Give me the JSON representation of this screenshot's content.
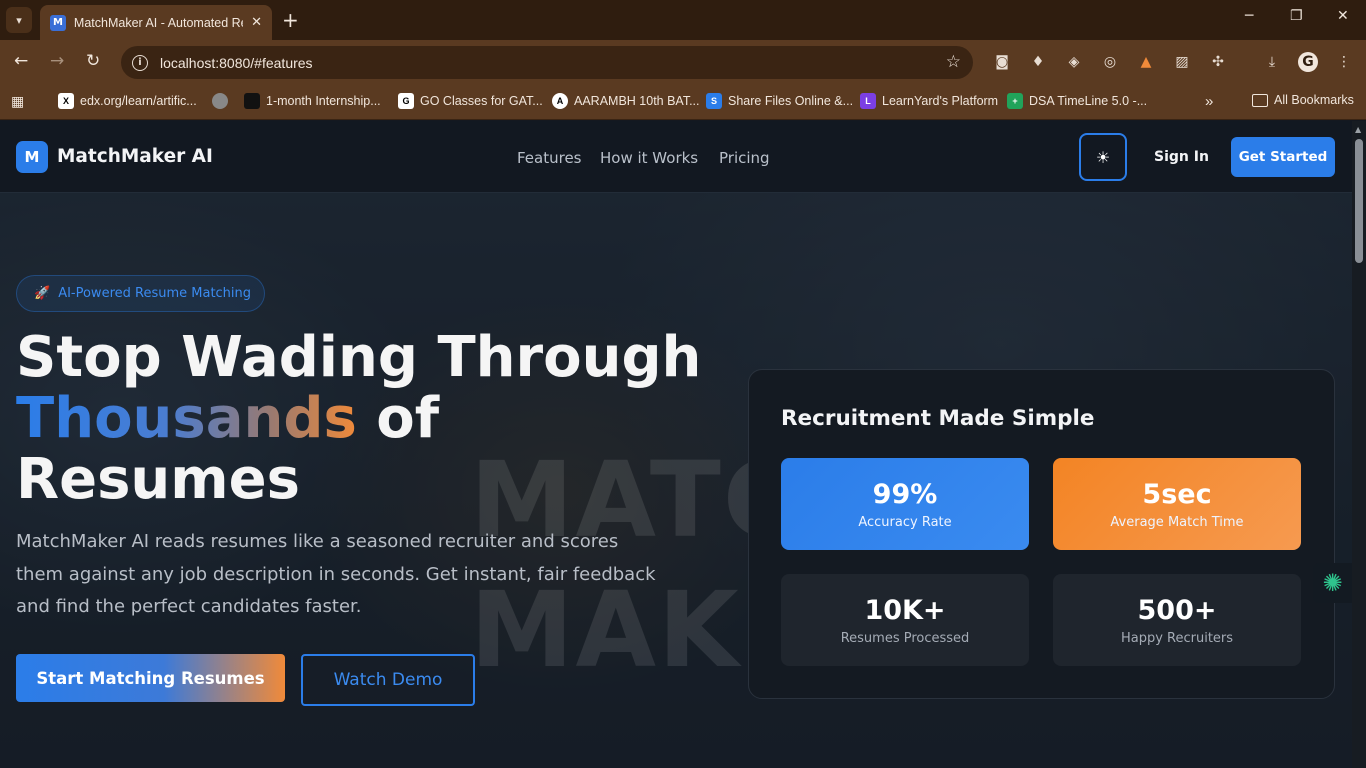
{
  "browser": {
    "tab_title": "MatchMaker AI - Automated Re",
    "tab_favicon": "M",
    "url": "localhost:8080/#features",
    "bookmarks": [
      {
        "label": "edx.org/learn/artific...",
        "icon": "X"
      },
      {
        "label": "1-month Internship...",
        "icon": ""
      },
      {
        "label": "GO Classes for GAT...",
        "icon": "G"
      },
      {
        "label": "AARAMBH 10th BAT...",
        "icon": "A"
      },
      {
        "label": "Share Files Online &...",
        "icon": "S"
      },
      {
        "label": "LearnYard's Platform",
        "icon": "L"
      },
      {
        "label": "DSA TimeLine 5.0 -...",
        "icon": "+"
      }
    ],
    "all_bookmarks": "All Bookmarks"
  },
  "site": {
    "logo_letter": "M",
    "brand": "MatchMaker AI",
    "nav": [
      "Features",
      "How it Works",
      "Pricing"
    ],
    "sign_in": "Sign In",
    "get_started": "Get Started"
  },
  "hero": {
    "badge": "AI-Powered Resume Matching",
    "headline_line1": "Stop Wading Through",
    "headline_highlight": "Thousands",
    "headline_of": " of",
    "headline_line3": "Resumes",
    "subtext": "MatchMaker AI reads resumes like a seasoned recruiter and scores them against any job description in seconds. Get instant, fair feedback and find the perfect candidates faster.",
    "primary_cta": "Start Matching Resumes",
    "secondary_cta": "Watch Demo",
    "watermark_1": "MATC",
    "watermark_2": "MAKE"
  },
  "stats_card": {
    "title": "Recruitment Made Simple",
    "stats": [
      {
        "value": "99%",
        "label": "Accuracy Rate"
      },
      {
        "value": "5sec",
        "label": "Average Match Time"
      },
      {
        "value": "10K+",
        "label": "Resumes Processed"
      },
      {
        "value": "500+",
        "label": "Happy Recruiters"
      }
    ]
  },
  "colors": {
    "accent_blue": "#2b7de9",
    "accent_orange": "#f38424",
    "chrome_brown": "#5a3a21"
  }
}
